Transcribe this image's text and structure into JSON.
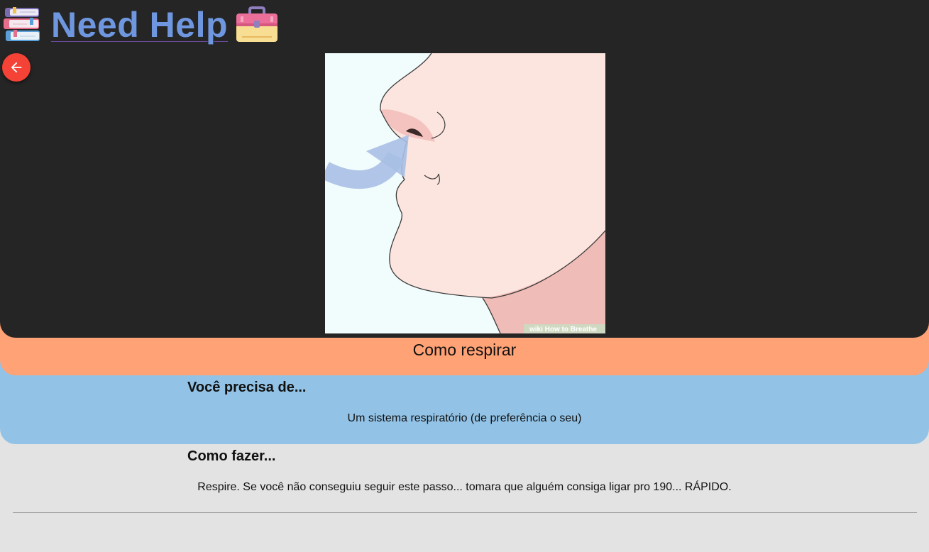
{
  "header": {
    "title": "Need Help",
    "books_icon": "books-stack-icon",
    "toolbox_icon": "toolbox-icon"
  },
  "nav": {
    "back_icon": "arrow-left-icon"
  },
  "illustration": {
    "watermark": "wiki How to Breathe"
  },
  "recipe": {
    "title": "Como respirar"
  },
  "needs": {
    "heading": "Você precisa de...",
    "text": "Um sistema respiratório (de preferência o seu)"
  },
  "howto": {
    "heading": "Como fazer...",
    "text": "Respire. Se você não conseguiu seguir este passo... tomara que alguém consiga ligar pro 190... RÁPIDO."
  },
  "colors": {
    "header_bg": "#252525",
    "title_link": "#6f97df",
    "back_button": "#f44336",
    "title_band": "#ffa275",
    "needs_band": "#92c2e5",
    "page_bg": "#e3e3e3"
  }
}
